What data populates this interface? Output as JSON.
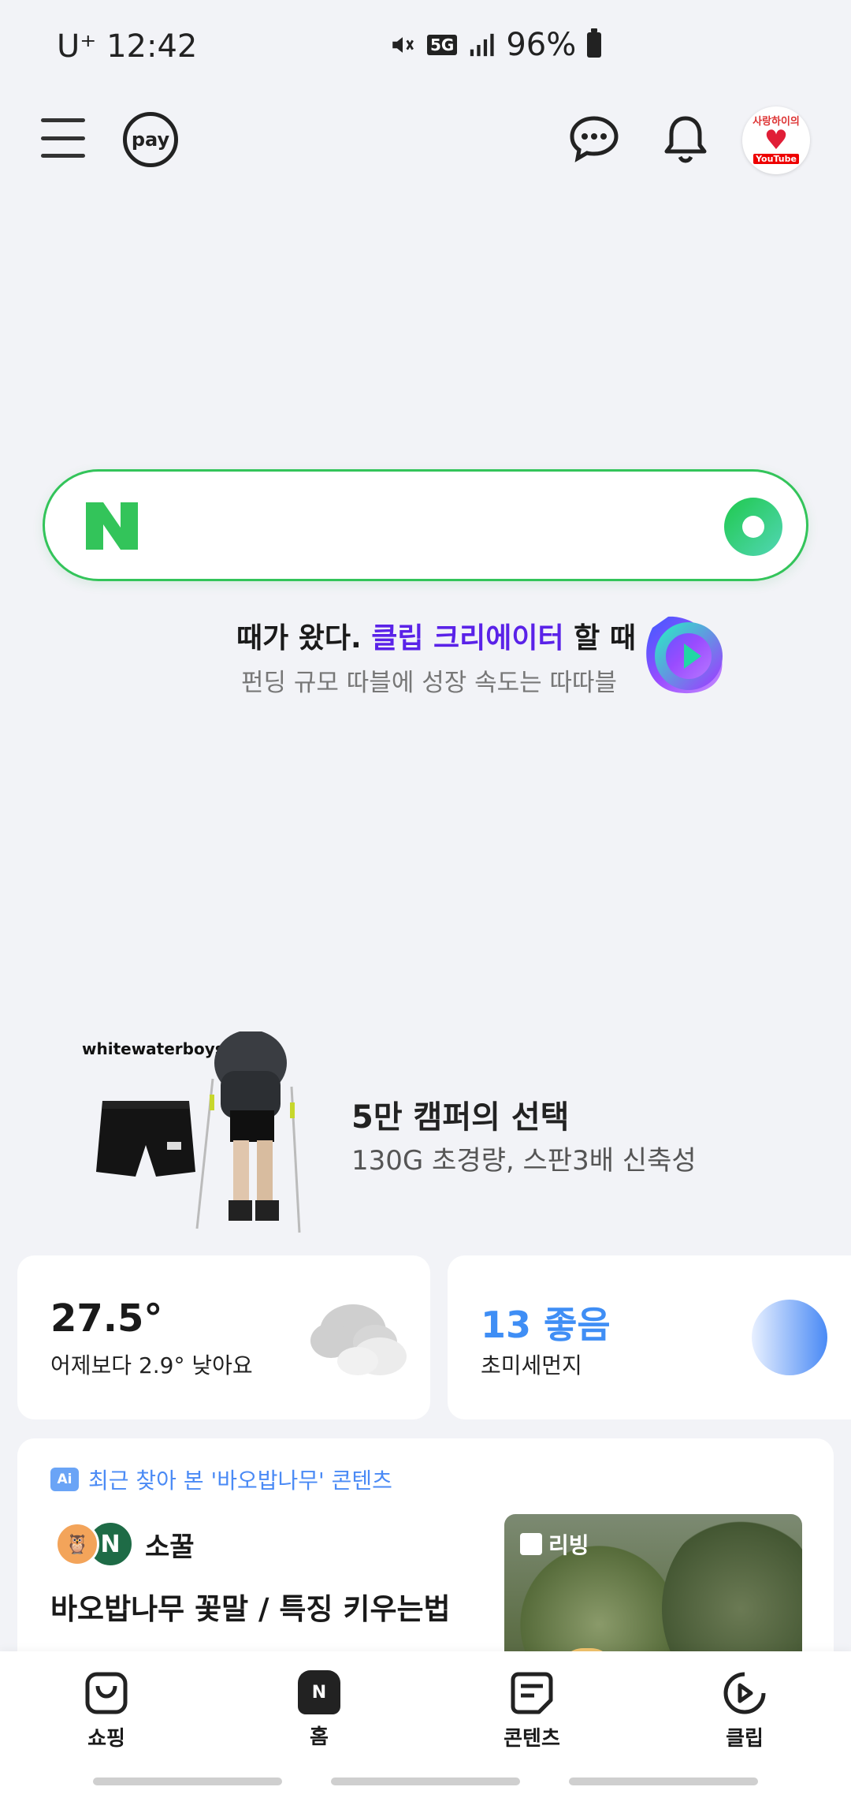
{
  "status_bar": {
    "carrier": "U⁺ 12:42",
    "network": "5G",
    "battery": "96%"
  },
  "topbar": {
    "pay_label": "pay",
    "avatar": {
      "top_text": "사랑하이의",
      "bottom_text": "YouTube"
    }
  },
  "search": {
    "placeholder": "",
    "logo_letter": "N"
  },
  "promo": {
    "line1_prefix": "때가 왔다.",
    "line1_accent": "클립 크리에이터",
    "line1_suffix": "할 때",
    "line2": "펀딩 규모 따블에 성장 속도는 따따블"
  },
  "ad": {
    "brand": "whitewaterboys®",
    "title": "5만 캠퍼의 선택",
    "subtitle": "130G 초경량, 스판3배 신축성"
  },
  "weather": {
    "temperature": "27.5°",
    "description": "어제보다 2.9° 낮아요"
  },
  "dust": {
    "value": "13 좋음",
    "label": "초미세먼지"
  },
  "content": {
    "ai_badge": "Ai",
    "ai_tag": "최근 찾아 본 '바오밥나무' 콘텐츠",
    "author_badge": "N",
    "author": "소꿀",
    "title": "바오밥나무 꽃말 / 특징 키우는법",
    "thumb_tag": "리빙"
  },
  "bottom_nav": {
    "items": [
      {
        "label": "쇼핑",
        "icon": "shopping-bag-icon"
      },
      {
        "label": "홈",
        "icon": "naver-home-icon"
      },
      {
        "label": "콘텐츠",
        "icon": "contents-icon"
      },
      {
        "label": "클립",
        "icon": "clip-play-icon"
      }
    ]
  },
  "colors": {
    "accent_green": "#33c45a",
    "clip_purple": "#5a22e8",
    "dust_blue": "#3f8ef5"
  }
}
